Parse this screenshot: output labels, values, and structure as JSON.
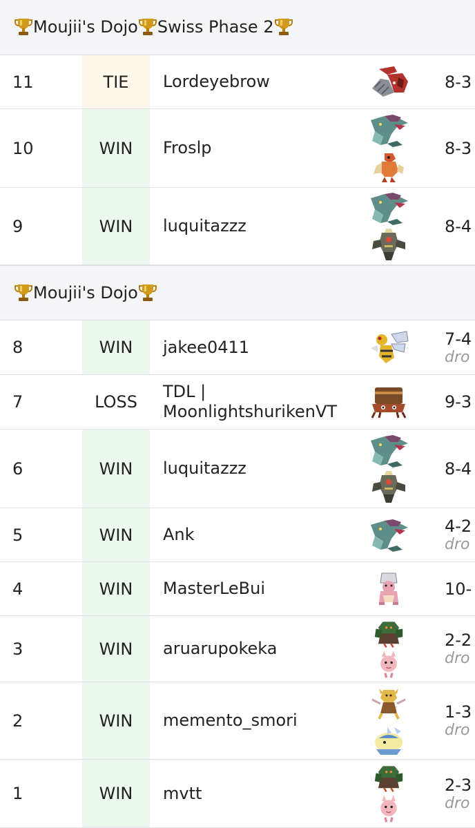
{
  "colors": {
    "win_bg": "#ecf8ee",
    "tie_bg": "#fdf7ec",
    "header_bg": "#f5f5f7",
    "trophy": "#d19a1a"
  },
  "sections": [
    {
      "title_parts": [
        "Moujii's Dojo",
        "Swiss Phase 2"
      ],
      "rows": [
        {
          "round": "11",
          "result": "TIE",
          "opponent": "Lordeyebrow",
          "record": "8-3",
          "dropped": "",
          "team": [
            "drill-pokemon-icon"
          ]
        },
        {
          "round": "10",
          "result": "WIN",
          "opponent": "Froslp",
          "record": "8-3",
          "dropped": "",
          "team": [
            "dragapult-icon",
            "blaziken-icon"
          ]
        },
        {
          "round": "9",
          "result": "WIN",
          "opponent": "luquitazzz",
          "record": "8-4",
          "dropped": "",
          "team": [
            "dragapult-icon",
            "dusknoir-icon"
          ]
        }
      ]
    },
    {
      "title_parts": [
        "Moujii's Dojo"
      ],
      "rows": [
        {
          "round": "8",
          "result": "WIN",
          "opponent": "jakee0411",
          "record": "7-4",
          "dropped": "dro",
          "team": [
            "beedrill-icon"
          ]
        },
        {
          "round": "7",
          "result": "LOSS",
          "opponent": "TDL | MoonlightshurikenVT",
          "record": "9-3",
          "dropped": "",
          "team": [
            "crab-pokemon-icon"
          ]
        },
        {
          "round": "6",
          "result": "WIN",
          "opponent": "luquitazzz",
          "record": "8-4",
          "dropped": "",
          "team": [
            "dragapult-icon",
            "dusknoir-icon"
          ]
        },
        {
          "round": "5",
          "result": "WIN",
          "opponent": "Ank",
          "record": "4-2",
          "dropped": "dro",
          "team": [
            "dragapult-icon"
          ]
        },
        {
          "round": "4",
          "result": "WIN",
          "opponent": "MasterLeBui",
          "record": "10-",
          "dropped": "",
          "team": [
            "slowking-icon"
          ]
        },
        {
          "round": "3",
          "result": "WIN",
          "opponent": "aruarupokeka",
          "record": "2-2",
          "dropped": "dro",
          "team": [
            "decidueye-icon",
            "clefairy-icon"
          ]
        },
        {
          "round": "2",
          "result": "WIN",
          "opponent": "memento_smori",
          "record": "1-3",
          "dropped": "dro",
          "team": [
            "alakazam-icon",
            "dunsparce-icon"
          ]
        },
        {
          "round": "1",
          "result": "WIN",
          "opponent": "mvtt",
          "record": "2-3",
          "dropped": "dro",
          "team": [
            "decidueye-icon",
            "clefairy-icon"
          ]
        }
      ]
    }
  ]
}
